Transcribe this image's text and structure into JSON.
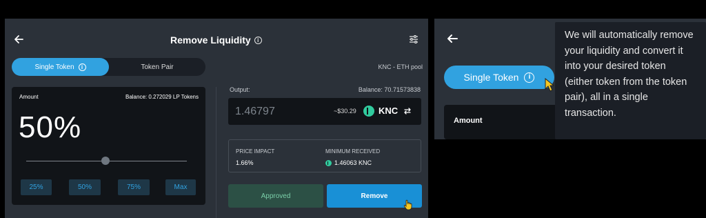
{
  "header": {
    "title": "Remove Liquidity",
    "back_icon": "arrow-left-icon",
    "info_icon": "info-icon",
    "settings_icon": "sliders-icon"
  },
  "tabs": {
    "single_token": "Single Token",
    "token_pair": "Token Pair"
  },
  "pool_label": "KNC - ETH pool",
  "amount_card": {
    "label": "Amount",
    "balance": "Balance: 0.272029 LP Tokens",
    "percent": "50%",
    "slider_fraction": 0.5,
    "presets": [
      "25%",
      "50%",
      "75%",
      "Max"
    ]
  },
  "output": {
    "label": "Output:",
    "balance": "Balance: 70.71573838",
    "value": "1.46797",
    "usd": "~$30.29",
    "token": "KNC",
    "token_icon": "knc-logo-icon",
    "swap_icon": "swap-arrows-icon"
  },
  "stats": {
    "price_impact_label": "PRICE IMPACT",
    "price_impact_value": "1.66%",
    "min_received_label": "MINIMUM RECEIVED",
    "min_received_value": "1.46063 KNC"
  },
  "buttons": {
    "approved": "Approved",
    "remove": "Remove"
  },
  "zoom": {
    "single_token": "Single Token",
    "amount_label": "Amount",
    "tooltip": "We will automatically remove your liquidity and convert it into your desired token (either token from the token pair), all in a single transaction."
  },
  "colors": {
    "accent": "#31a2e0",
    "remove_button": "#1990d6",
    "approved_button": "#2c5045",
    "knc_green": "#31cb9e",
    "panel_bg": "#2b3139",
    "card_bg": "#111418"
  }
}
